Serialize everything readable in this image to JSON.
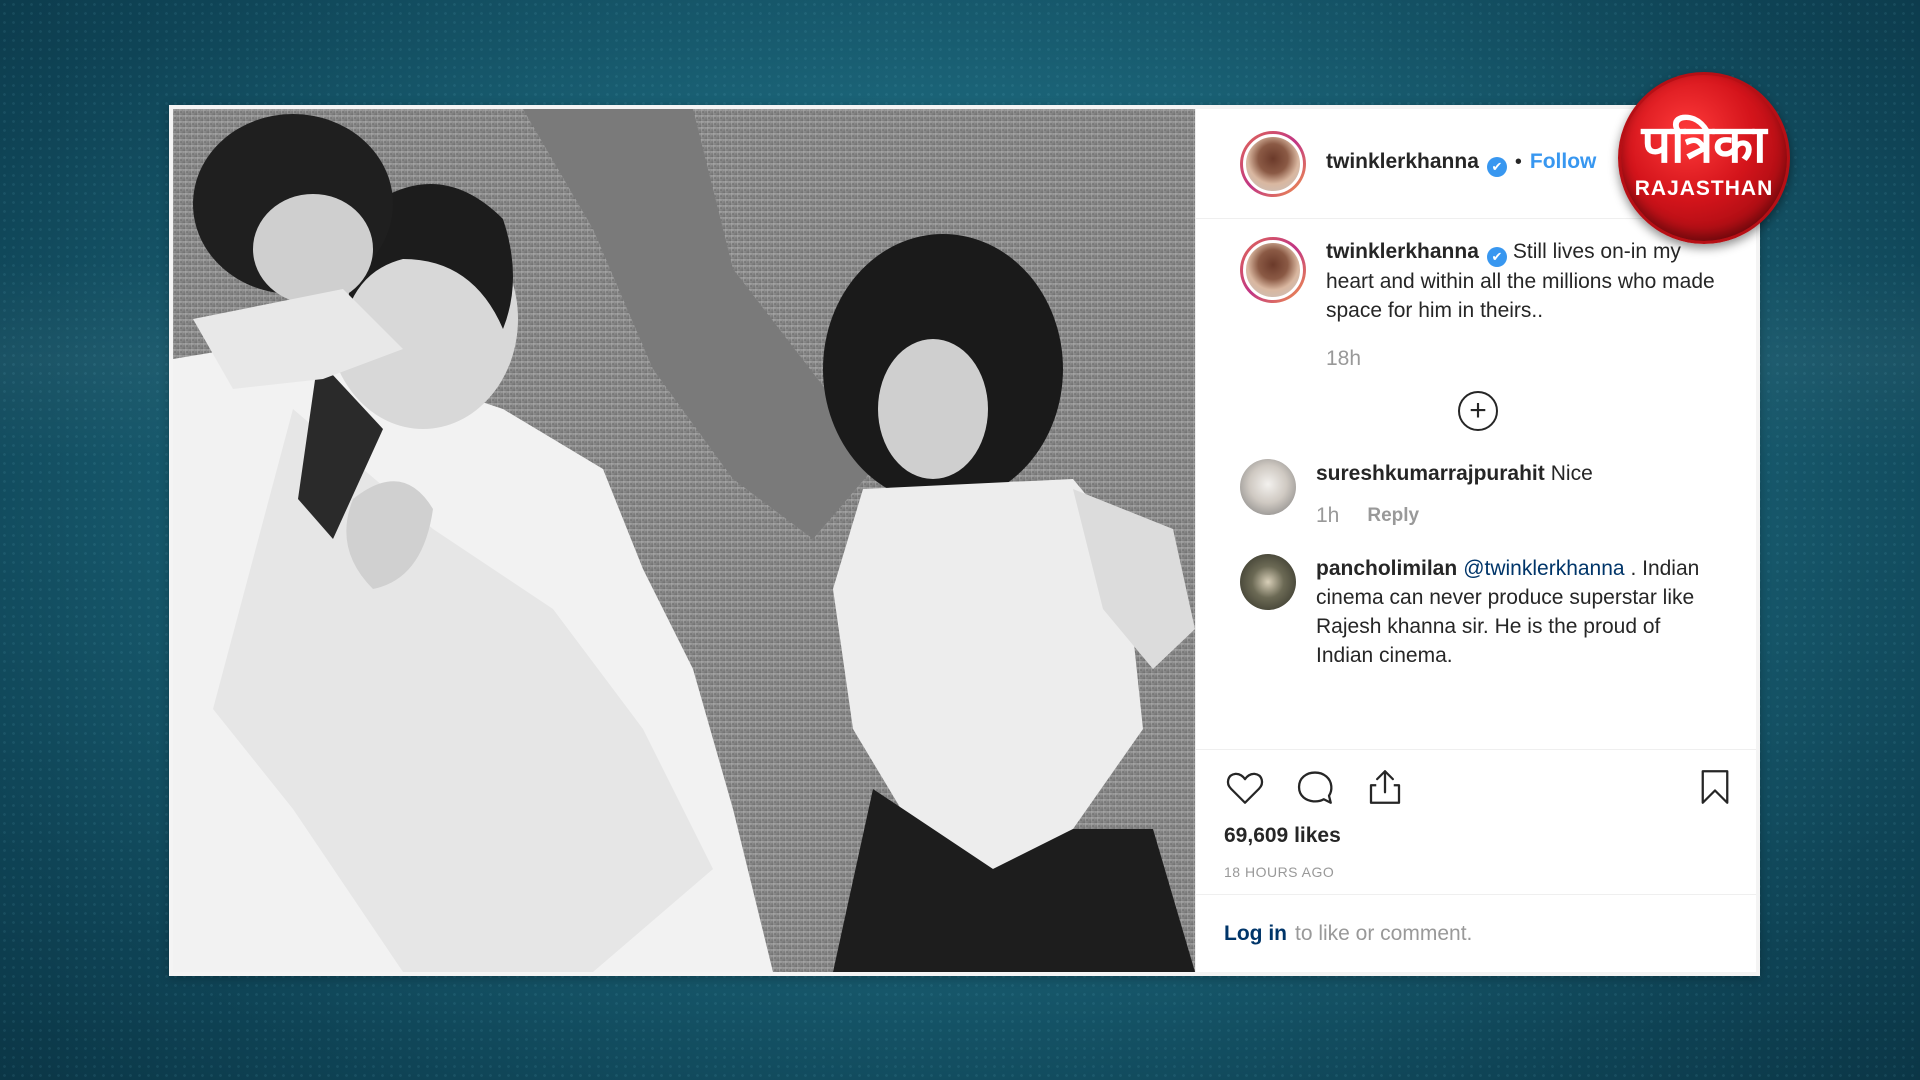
{
  "post": {
    "author": "twinklerkhanna",
    "separator": "•",
    "follow_label": "Follow",
    "verified_mark": "✔",
    "caption": {
      "username": "twinklerkhanna",
      "text": "Still lives on-in my heart and within all the millions who made space for him in theirs..",
      "age": "18h"
    },
    "load_more_symbol": "+",
    "comments": [
      {
        "username": "sureshkumarrajpurahit",
        "text": "Nice",
        "age": "1h",
        "reply_label": "Reply"
      },
      {
        "username": "pancholimilan",
        "mention": "@twinklerkhanna",
        "text": ". Indian cinema can never produce superstar like Rajesh khanna sir. He is the proud of Indian cinema."
      }
    ],
    "likes": "69,609 likes",
    "timestamp": "18 HOURS AGO",
    "login_link": "Log in",
    "login_rest": "to like or comment."
  },
  "icons": {
    "like": "heart-icon",
    "comment": "comment-icon",
    "share": "share-icon",
    "save": "bookmark-icon",
    "load_more": "plus-circle-icon"
  },
  "logo": {
    "hindi": "पत्रिका",
    "latin": "RAJASTHAN"
  },
  "colors": {
    "background": "#1b6478",
    "link_blue": "#3897f0",
    "logo_red": "#d4141b"
  }
}
